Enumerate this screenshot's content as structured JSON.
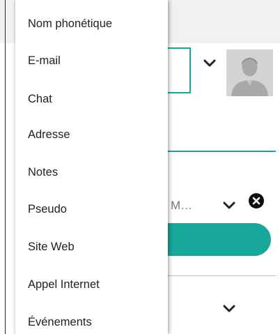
{
  "background": {
    "field_label": "M…",
    "icons": {
      "expand": "chevron-down-icon",
      "remove": "close-icon",
      "photo": "avatar-placeholder-icon"
    },
    "colors": {
      "accent": "#1aa39a",
      "remove_button": "#0d0d0d"
    }
  },
  "menu": {
    "items": [
      {
        "label": "Nom phonétique"
      },
      {
        "label": "E-mail"
      },
      {
        "label": "Chat"
      },
      {
        "label": "Adresse"
      },
      {
        "label": "Notes"
      },
      {
        "label": "Pseudo"
      },
      {
        "label": "Site Web"
      },
      {
        "label": "Appel Internet"
      },
      {
        "label": "Événements"
      }
    ]
  }
}
